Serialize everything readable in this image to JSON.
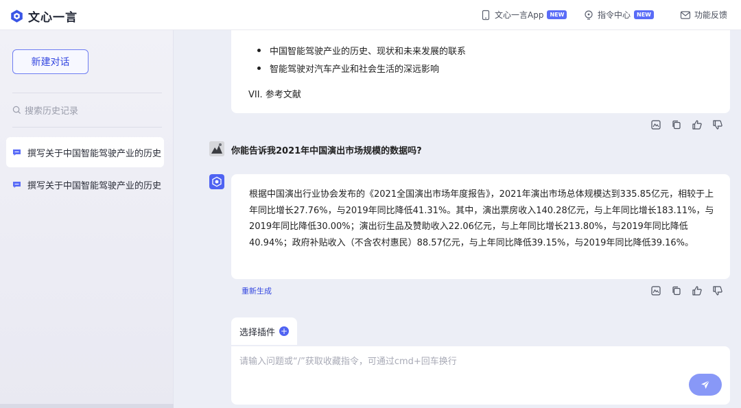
{
  "header": {
    "logo_text": "文心一言",
    "app_label": "文心一言App",
    "app_badge": "NEW",
    "commands_label": "指令中心",
    "commands_badge": "NEW",
    "feedback_label": "功能反馈"
  },
  "sidebar": {
    "new_chat_label": "新建对话",
    "search_placeholder": "搜索历史记录",
    "history": [
      {
        "title": "撰写关于中国智能驾驶产业的历史"
      },
      {
        "title": "撰写关于中国智能驾驶产业的历史"
      }
    ]
  },
  "chat": {
    "previous_bullets": [
      "中国智能驾驶产业的历史、现状和未来发展的联系",
      "智能驾驶对汽车产业和社会生活的深远影响"
    ],
    "previous_ref": "VII. 参考文献",
    "question": "你能告诉我2021年中国演出市场规模的数据吗?",
    "answer": "根据中国演出行业协会发布的《2021全国演出市场年度报告》，2021年演出市场总体规模达到335.85亿元，相较于上年同比增长27.76%，与2019年同比降低41.31%。其中，演出票房收入140.28亿元，与上年同比增长183.11%，与2019年同比降低30.00%；演出衍生品及赞助收入22.06亿元，与上年同比增长213.80%，与2019年同比降低40.94%；政府补贴收入（不含农村惠民）88.57亿元，与上年同比降低39.15%，与2019年同比降低39.16%。",
    "regenerate_label": "重新生成"
  },
  "composer": {
    "plugin_label": "选择插件",
    "input_placeholder": "请输入问题或“/”获取收藏指令，可通过cmd+回车换行",
    "input_value": ""
  },
  "colors": {
    "accent": "#4f63f2",
    "send_button": "#8898f7"
  }
}
